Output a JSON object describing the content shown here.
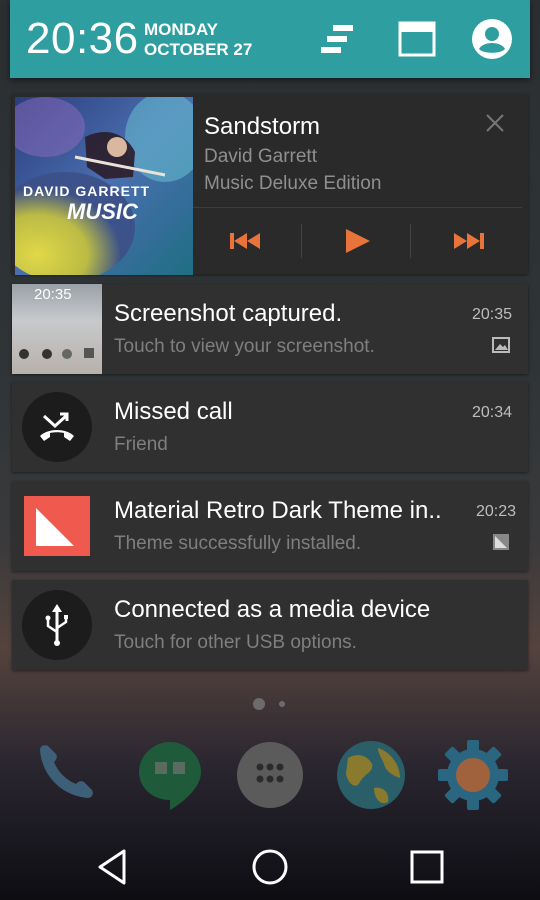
{
  "header": {
    "time": "20:36",
    "day": "MONDAY",
    "date": "OCTOBER 27",
    "icons": [
      "settings-sliders-icon",
      "quick-settings-icon",
      "account-icon"
    ]
  },
  "media": {
    "title": "Sandstorm",
    "artist": "David Garrett",
    "album": "Music Deluxe Edition",
    "album_art_text": "DAVID GARRETT",
    "album_art_subtext": "MUSIC",
    "controls": [
      "previous-icon",
      "play-icon",
      "next-icon"
    ]
  },
  "notifications": [
    {
      "title": "Screenshot captured.",
      "subtitle": "Touch to view your screenshot.",
      "time": "20:35",
      "thumb_clock": "20:35"
    },
    {
      "title": "Missed call",
      "subtitle": "Friend",
      "time": "20:34"
    },
    {
      "title": "Material Retro Dark Theme in..",
      "subtitle": "Theme successfully installed.",
      "time": "20:23"
    },
    {
      "title": "Connected as a media device",
      "subtitle": "Touch for other USB options.",
      "time": ""
    }
  ],
  "colors": {
    "accent": "#2f9ea0",
    "card": "#303030",
    "play_orange": "#e8743b",
    "theme_red": "#f05a4e"
  },
  "dock": [
    "phone-icon",
    "hangouts-icon",
    "app-drawer-icon",
    "earth-icon",
    "settings-gear-icon"
  ],
  "navbar": [
    "back-icon",
    "home-icon",
    "recents-icon"
  ]
}
